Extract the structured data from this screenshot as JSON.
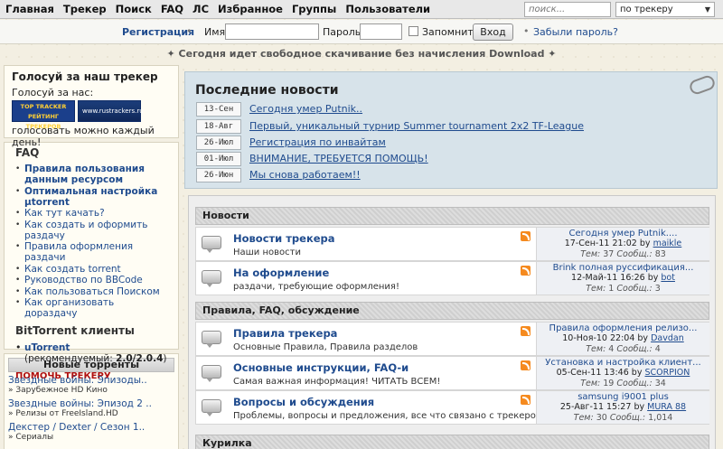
{
  "topnav": {
    "items": [
      "Главная",
      "Трекер",
      "Поиск",
      "FAQ",
      "ЛС",
      "Избранное",
      "Группы",
      "Пользователи"
    ],
    "search_placeholder": "поиск...",
    "search_scope": "по трекеру"
  },
  "login": {
    "register": "Регистрация",
    "name_label": "Имя:",
    "password_label": "Пароль:",
    "remember": "Запомнить",
    "login_button": "Вход",
    "forgot": "Забыли пароль?"
  },
  "announce": "Сегодня идет свободное скачивание без начисления Download",
  "vote": {
    "title": "Голосуй за наш трекер",
    "subtitle": "Голосуй за нас:",
    "badge1": "TOP TRACKER РЕЙТИНГ ТРЕКЕРОВ",
    "badge2": "www.rustrackers.ru",
    "footer": "голосовать можно каждый день!"
  },
  "faq": {
    "title": "FAQ",
    "items": [
      "Правила пользования данным ресурсом",
      "Оптимальная настройка µtorrent",
      "Как тут качать?",
      "Как создать и оформить раздачу",
      "Правила оформления раздачи",
      "Как создать torrent",
      "Руководство по BBCode",
      "Как пользоваться Поиском",
      "Как организовать дораздачу"
    ],
    "bt_title": "BitTorrent клиенты",
    "bt_client": "uTorrent",
    "bt_rec_prefix": "(рекомендуемый: ",
    "bt_rec_version": "2.0/2.0.4",
    "bt_rec_suffix": ")",
    "help": "ПОМОЧЬ ТРЕКЕРУ"
  },
  "new_torrents": {
    "title": "Новые торренты",
    "items": [
      {
        "title": "Звездные войны. Эпизоды..",
        "cat": "» Зарубежное HD Кино"
      },
      {
        "title": "Звездные войны: Эпизод 2 ..",
        "cat": "» Релизы от FreeIsland.HD"
      },
      {
        "title": "Декстер / Dexter / Сезон 1..",
        "cat": "» Сериалы"
      }
    ]
  },
  "news": {
    "title": "Последние новости",
    "items": [
      {
        "date": "13-Сен",
        "text": "Сегодня умер Putnik.."
      },
      {
        "date": "18-Авг",
        "text": "Первый, уникальный турнир Summer tournament 2x2 TF-League"
      },
      {
        "date": "26-Июл",
        "text": "Регистрация по инвайтам"
      },
      {
        "date": "01-Июл",
        "text": "ВНИМАНИЕ, ТРЕБУЕТСЯ ПОМОЩЬ!"
      },
      {
        "date": "26-Июн",
        "text": "Мы снова работаем!!"
      }
    ]
  },
  "forums": {
    "topics_label": "Тем:",
    "posts_label": "Сообщ.:",
    "by_label": "by",
    "categories": [
      {
        "name": "Новости",
        "rows": [
          {
            "name": "Новости трекера",
            "desc": "Наши новости",
            "last_title": "Сегодня умер Putnik....",
            "last_date": "17-Сен-11 21:02",
            "last_user": "maikle",
            "topics": "37",
            "posts": "83"
          },
          {
            "name": "На оформление",
            "desc": "раздачи, требующие оформления!",
            "last_title": "Brink полная руссификация...",
            "last_date": "12-Май-11 16:26",
            "last_user": "bot",
            "topics": "1",
            "posts": "3"
          }
        ]
      },
      {
        "name": "Правила, FAQ, обсуждение",
        "rows": [
          {
            "name": "Правила трекера",
            "desc": "Основные Правила, Правила разделов",
            "last_title": "Правила оформления релизо...",
            "last_date": "10-Ноя-10 22:04",
            "last_user": "Davdan",
            "topics": "4",
            "posts": "4"
          },
          {
            "name": "Основные инструкции, FAQ-и",
            "desc": "Самая важная информация! ЧИТАТЬ ВСЕМ!",
            "last_title": "Установка и настройка клиент...",
            "last_date": "05-Сен-11 13:46",
            "last_user": "SCORPION",
            "topics": "19",
            "posts": "34"
          },
          {
            "name": "Вопросы и обсуждения",
            "desc": "Проблемы, вопросы и предложения, все что связано с трекером",
            "last_title": "samsung i9001 plus",
            "last_date": "25-Авг-11 15:27",
            "last_user": "MURA 88",
            "topics": "30",
            "posts": "1,014"
          }
        ]
      },
      {
        "name": "Курилка",
        "rows": []
      }
    ]
  }
}
